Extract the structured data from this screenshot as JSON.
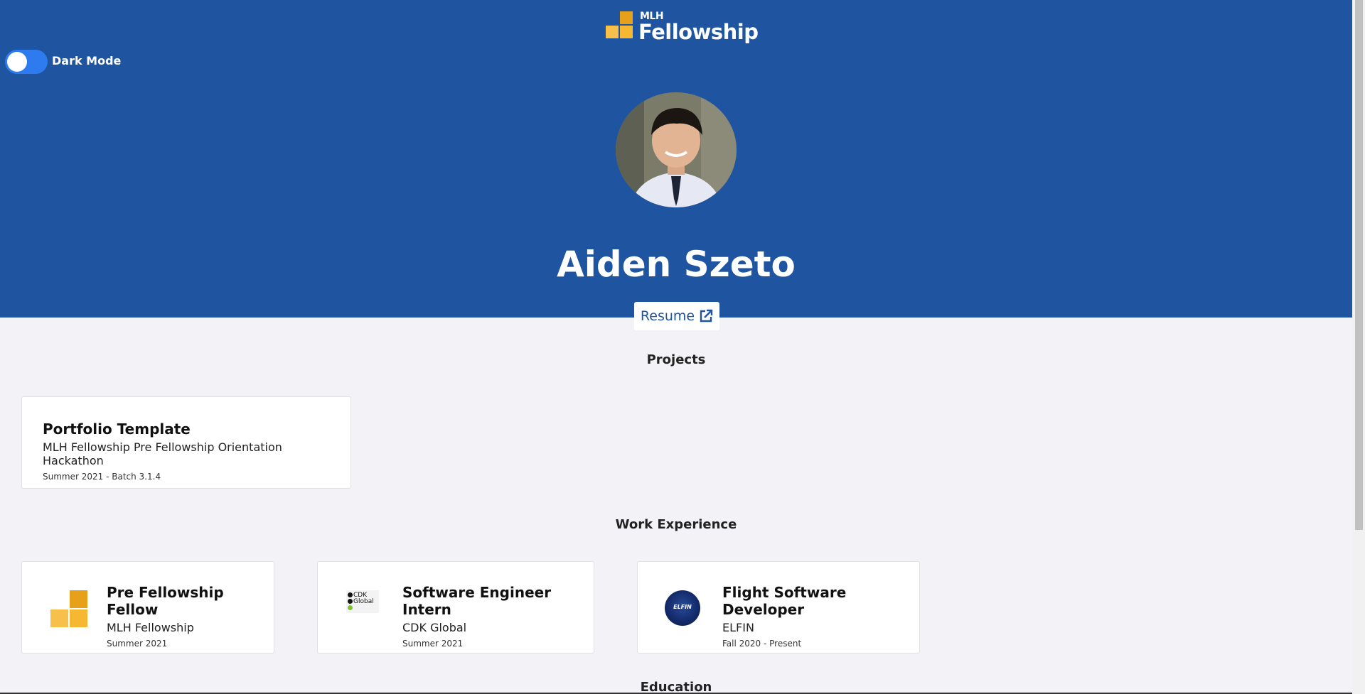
{
  "header": {
    "logo": {
      "small": "MLH",
      "large": "Fellowship"
    },
    "dark_mode_label": "Dark Mode",
    "name": "Aiden Szeto",
    "resume_label": "Resume"
  },
  "projects": {
    "title": "Projects",
    "items": [
      {
        "title": "Portfolio Template",
        "subtitle": "MLH Fellowship Pre Fellowship Orientation Hackathon",
        "date": "Summer 2021 - Batch 3.1.4"
      }
    ]
  },
  "work": {
    "title": "Work Experience",
    "items": [
      {
        "title": "Pre Fellowship Fellow",
        "company": "MLH Fellowship",
        "date": "Summer 2021",
        "logo": "mlh-logo"
      },
      {
        "title": "Software Engineer Intern",
        "company": "CDK Global",
        "date": "Summer 2021",
        "logo": "cdk-logo",
        "logo_text": "CDK Global"
      },
      {
        "title": "Flight Software Developer",
        "company": "ELFIN",
        "date": "Fall 2020 - Present",
        "logo": "elfin-logo",
        "logo_text": "ELFIN"
      }
    ]
  },
  "education": {
    "title": "Education"
  },
  "colors": {
    "header_bg": "#1f54a0",
    "toggle": "#2e7bf0",
    "mlh_gold": "#e6a019"
  }
}
